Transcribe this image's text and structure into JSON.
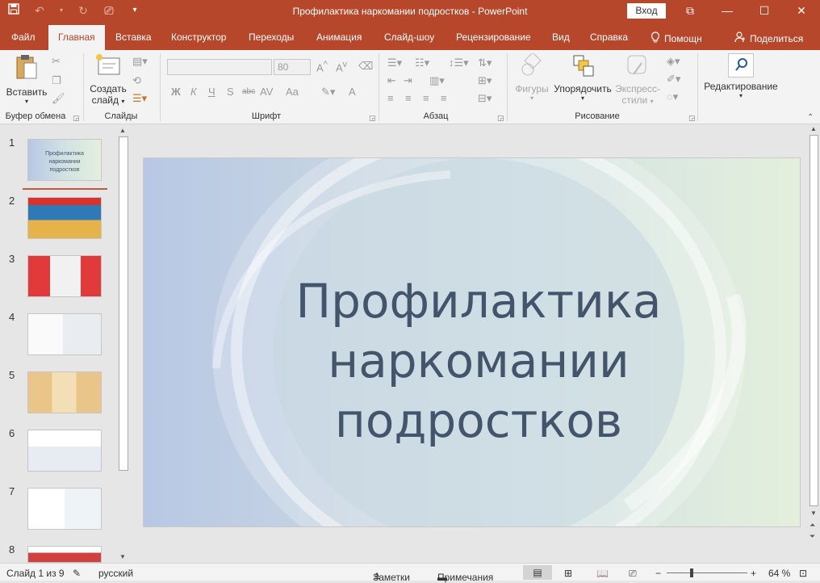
{
  "titlebar": {
    "title": "Профилактика наркомании подростков  -  PowerPoint",
    "signin": "Вход"
  },
  "tabs": [
    {
      "label": "Файл"
    },
    {
      "label": "Главная"
    },
    {
      "label": "Вставка"
    },
    {
      "label": "Конструктор"
    },
    {
      "label": "Переходы"
    },
    {
      "label": "Анимация"
    },
    {
      "label": "Слайд-шоу"
    },
    {
      "label": "Рецензирование"
    },
    {
      "label": "Вид"
    },
    {
      "label": "Справка"
    }
  ],
  "tellme": "Помощн",
  "share": "Поделиться",
  "ribbon": {
    "clipboard": {
      "paste": "Вставить",
      "label": "Буфер обмена"
    },
    "slides": {
      "new_slide_1": "Создать",
      "new_slide_2": "слайд",
      "label": "Слайды"
    },
    "font": {
      "size": "80",
      "label": "Шрифт",
      "bold": "Ж",
      "italic": "К",
      "underline": "Ч",
      "shadow": "S",
      "strike": "abc",
      "spacing": "AV",
      "case": "Aa",
      "color": "A"
    },
    "paragraph": {
      "label": "Абзац"
    },
    "drawing": {
      "shapes": "Фигуры",
      "arrange": "Упорядочить",
      "styles_1": "Экспресс-",
      "styles_2": "стили",
      "label": "Рисование"
    },
    "editing": {
      "label": "Редактирование"
    }
  },
  "slides_panel": {
    "numbers": [
      "1",
      "2",
      "3",
      "4",
      "5",
      "6",
      "7",
      "8"
    ]
  },
  "thumb1_text": "Профилактика наркомании подростков",
  "slide": {
    "title_line1": "Профилактика",
    "title_line2": "наркомании",
    "title_line3": "подростков"
  },
  "status": {
    "slide_info": "Слайд 1 из 9",
    "language": "русский",
    "notes": "Заметки",
    "comments": "Примечания",
    "zoom": "64 %",
    "zoom_value": 64
  },
  "colors": {
    "accent": "#b7472a",
    "title_text": "#44546a"
  }
}
